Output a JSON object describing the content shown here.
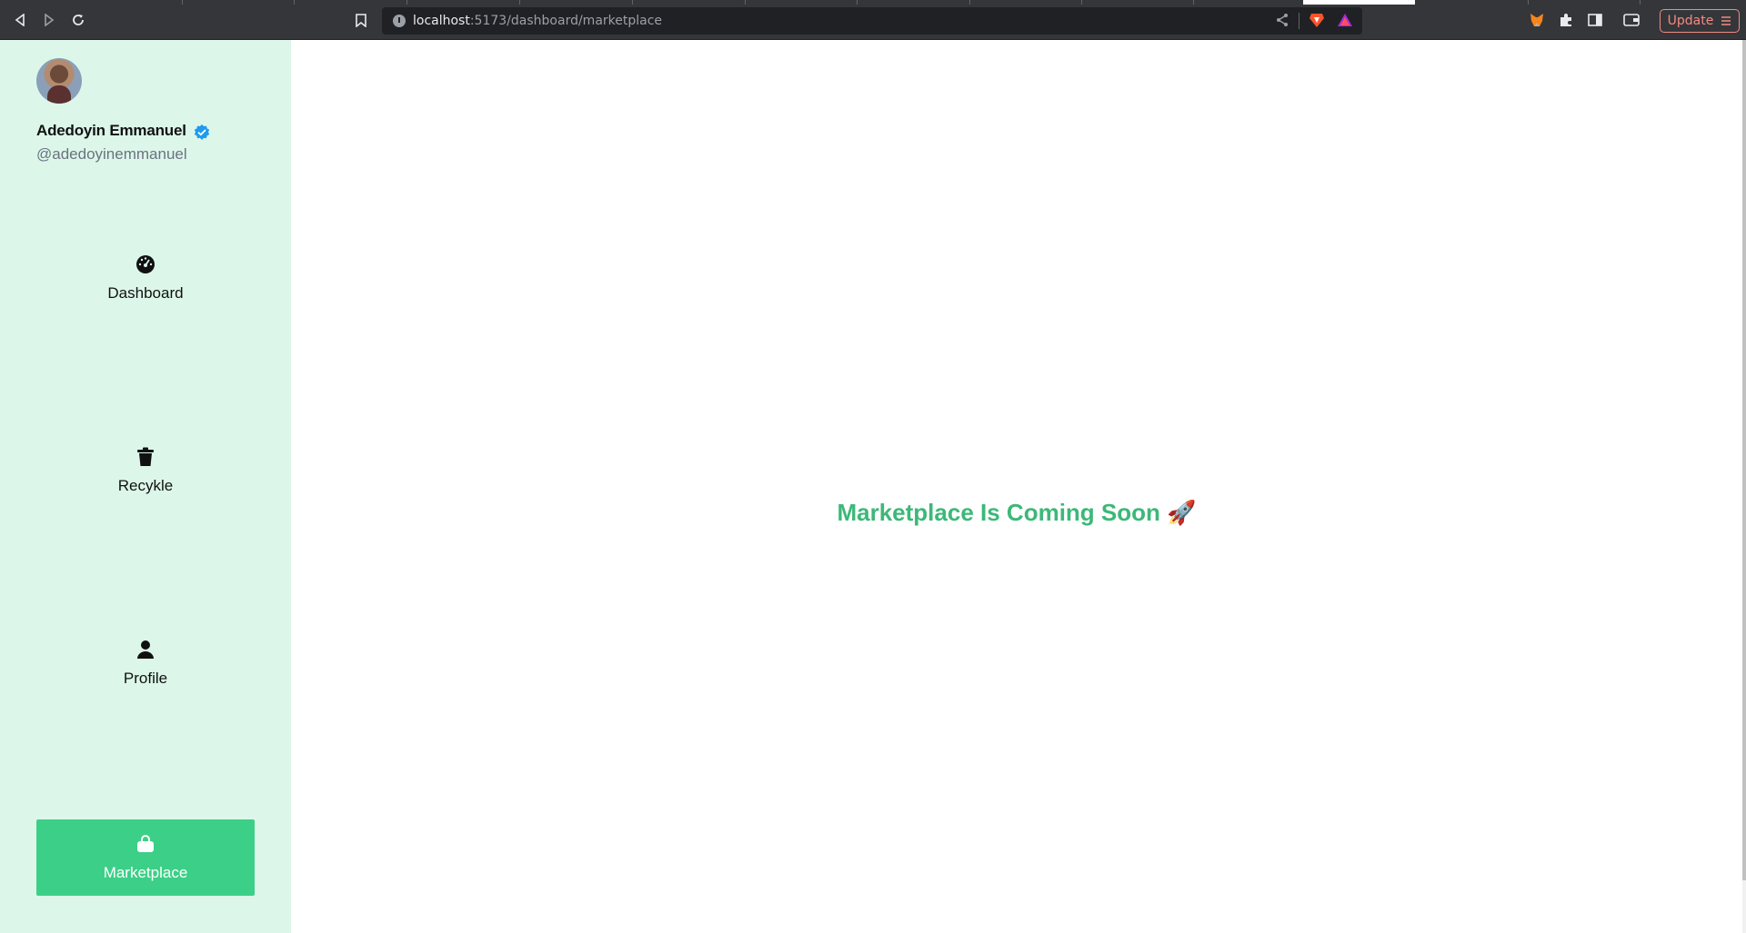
{
  "browser": {
    "url_host": "localhost",
    "url_path": ":5173/dashboard/marketplace",
    "update_label": "Update"
  },
  "user": {
    "name": "Adedoyin Emmanuel",
    "handle": "@adedoyinemmanuel",
    "verified": true
  },
  "sidebar": {
    "items": [
      {
        "label": "Dashboard",
        "icon": "dashboard-gauge-icon",
        "active": false
      },
      {
        "label": "Recykle",
        "icon": "trash-bin-icon",
        "active": false
      },
      {
        "label": "Profile",
        "icon": "user-icon",
        "active": false
      },
      {
        "label": "Marketplace",
        "icon": "shopping-bag-icon",
        "active": true
      }
    ]
  },
  "main": {
    "message": "Marketplace Is Coming Soon 🚀"
  },
  "colors": {
    "sidebar_bg": "#dcf7ea",
    "accent": "#3ccf87",
    "message_text": "#3cb878"
  }
}
